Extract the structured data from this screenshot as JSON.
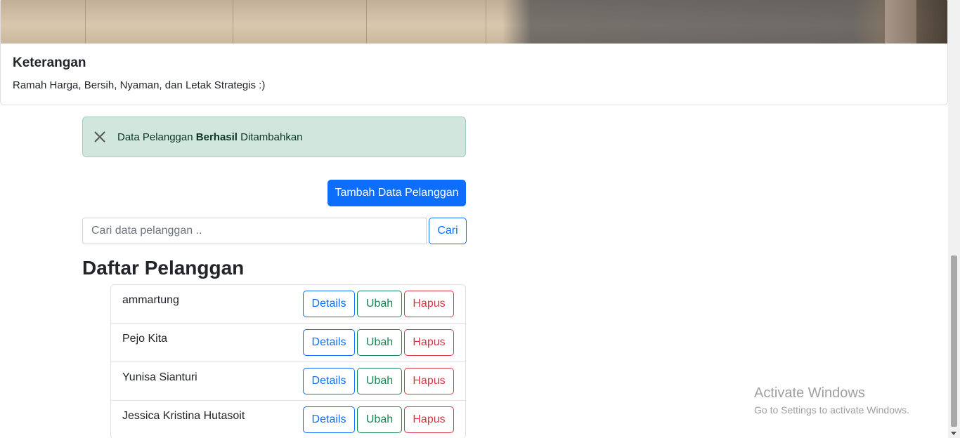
{
  "card": {
    "title": "Keterangan",
    "text": "Ramah Harga, Bersih, Nyaman, dan Letak Strategis :)"
  },
  "alert": {
    "prefix": "Data Pelanggan ",
    "strong": "Berhasil",
    "suffix": " Ditambahkan",
    "close_icon": "close-icon"
  },
  "add_button": "Tambah Data Pelanggan",
  "search": {
    "placeholder": "Cari data pelanggan ..",
    "button": "Cari"
  },
  "heading": "Daftar Pelanggan",
  "customers": [
    {
      "name": "ammartung"
    },
    {
      "name": "Pejo Kita"
    },
    {
      "name": "Yunisa Sianturi"
    },
    {
      "name": "Jessica Kristina Hutasoit"
    }
  ],
  "actions": {
    "details": "Details",
    "edit": "Ubah",
    "delete": "Hapus"
  },
  "watermark": {
    "line1": "Activate Windows",
    "line2": "Go to Settings to activate Windows."
  },
  "colors": {
    "primary": "#0d6efd",
    "success": "#198754",
    "danger": "#dc3545",
    "alert_bg": "#d1e7dd"
  }
}
